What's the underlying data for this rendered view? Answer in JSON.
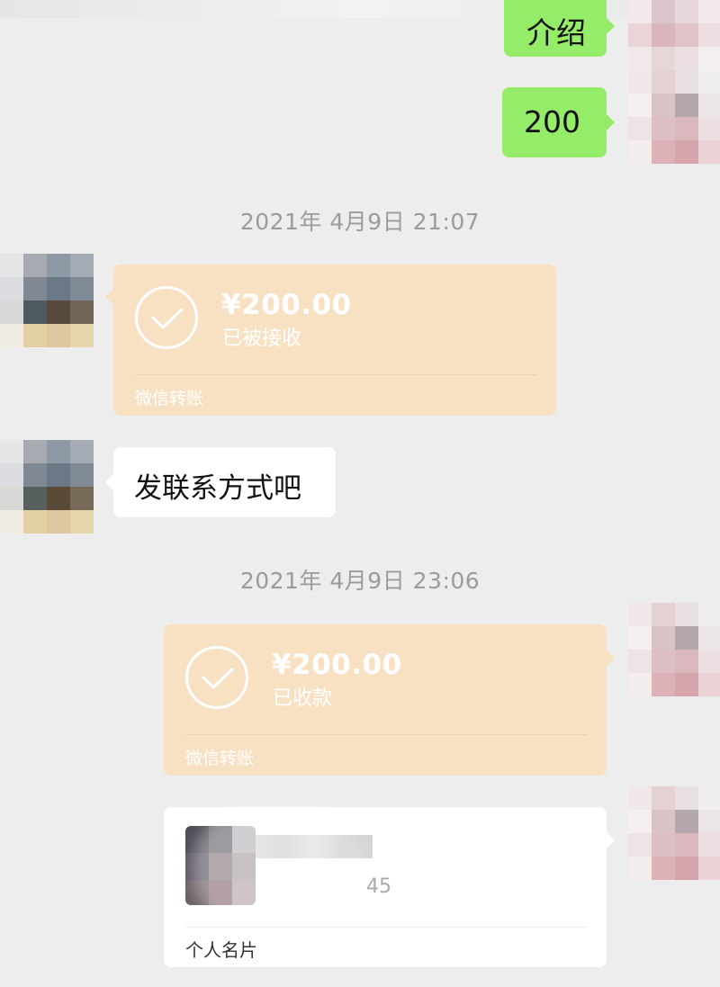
{
  "messages": {
    "intro_text": "介绍",
    "amount_text": "200",
    "ask_contact_text": "发联系方式吧"
  },
  "timestamps": {
    "first": "2021年 4月9日 21:07",
    "second": "2021年 4月9日 23:06"
  },
  "transfer_received": {
    "amount": "¥200.00",
    "status": "已被接收",
    "footer": "微信转账"
  },
  "transfer_collected": {
    "amount": "¥200.00",
    "status": "已收款",
    "footer": "微信转账"
  },
  "contact_card": {
    "number_suffix": "45",
    "footer": "个人名片"
  },
  "colors": {
    "background": "#ededed",
    "sent_bubble": "#95ec69",
    "received_bubble": "#ffffff",
    "transfer_card": "#f8e1c3",
    "timestamp": "#9b9b9b"
  },
  "icons": {
    "transfer_status": "check-circle-icon"
  }
}
